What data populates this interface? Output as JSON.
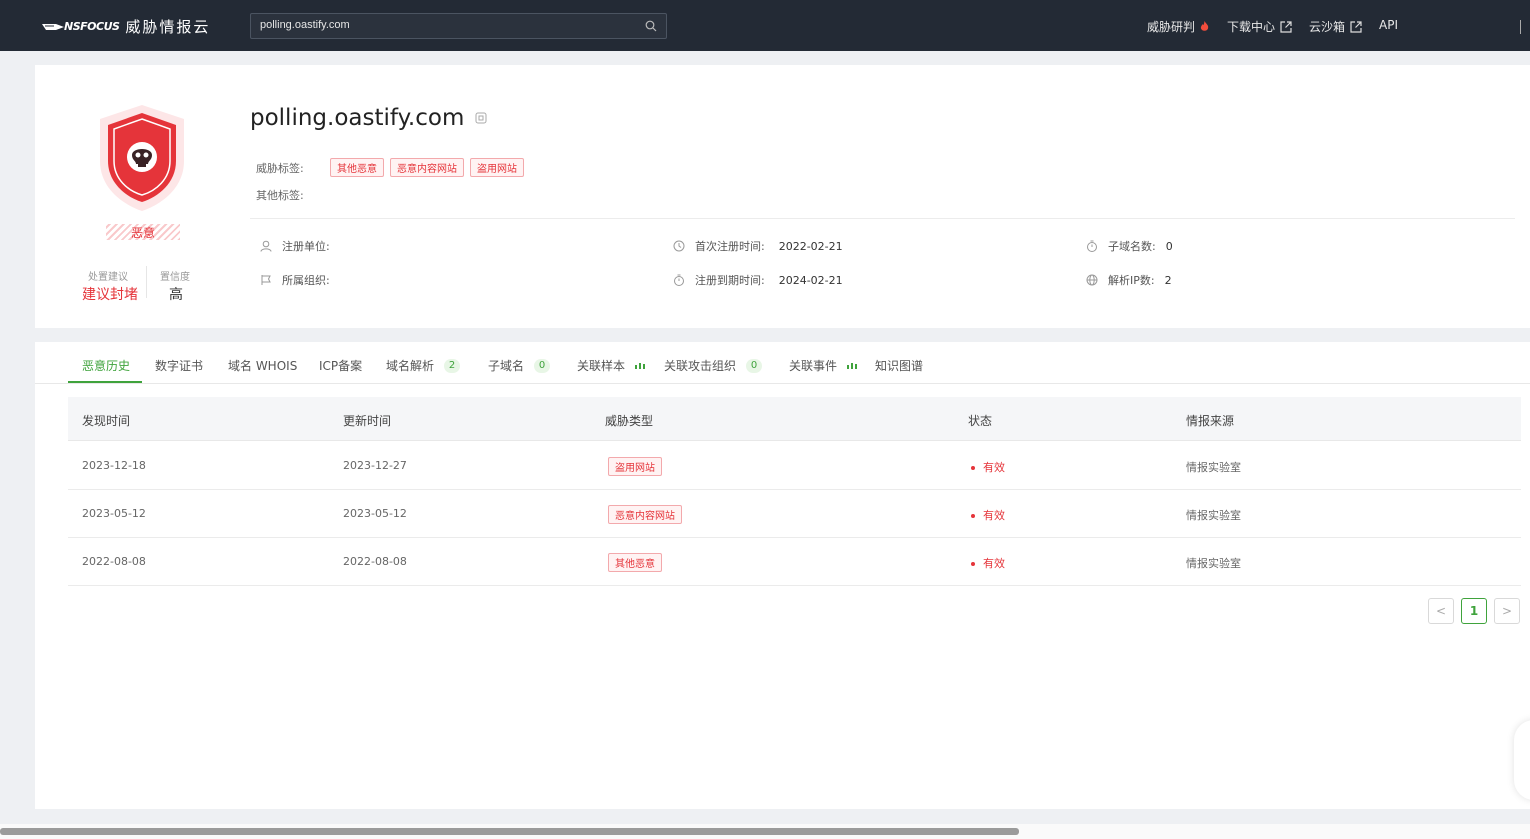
{
  "topbar": {
    "logo_mark": "NSFOCUS",
    "logo_text": "威胁情报云",
    "search_value": "polling.oastify.com",
    "nav": [
      {
        "label": "威胁研判"
      },
      {
        "label": "下载中心"
      },
      {
        "label": "云沙箱"
      },
      {
        "label": "API"
      }
    ]
  },
  "header": {
    "domain": "polling.oastify.com",
    "verdict": "恶意",
    "suggestion_title": "处置建议",
    "suggestion_value": "建议封堵",
    "confidence_title": "置信度",
    "confidence_value": "高",
    "threat_tags_label": "威胁标签:",
    "threat_tags": [
      "其他恶意",
      "恶意内容网站",
      "盗用网站"
    ],
    "other_tags_label": "其他标签:",
    "info": {
      "registrant_label": "注册单位:",
      "registrant_value": "",
      "org_label": "所属组织:",
      "org_value": "",
      "first_reg_label": "首次注册时间:",
      "first_reg_value": "2022-02-21",
      "expire_label": "注册到期时间:",
      "expire_value": "2024-02-21",
      "subdomain_count_label": "子域名数:",
      "subdomain_count_value": "0",
      "ip_count_label": "解析IP数:",
      "ip_count_value": "2"
    },
    "colors": {
      "danger": "#e5343a",
      "accent": "#3fa33c"
    }
  },
  "tabs": [
    {
      "label": "恶意历史"
    },
    {
      "label": "数字证书"
    },
    {
      "label": "域名 WHOIS"
    },
    {
      "label": "ICP备案"
    },
    {
      "label": "域名解析",
      "count": "2"
    },
    {
      "label": "子域名",
      "count": "0"
    },
    {
      "label": "关联样本"
    },
    {
      "label": "关联攻击组织",
      "count": "0"
    },
    {
      "label": "关联事件"
    },
    {
      "label": "知识图谱"
    }
  ],
  "table": {
    "headers": [
      "发现时间",
      "更新时间",
      "威胁类型",
      "状态",
      "情报来源"
    ],
    "rows": [
      {
        "found": "2023-12-18",
        "updated": "2023-12-27",
        "type": "盗用网站",
        "status": "有效",
        "source": "情报实验室"
      },
      {
        "found": "2023-05-12",
        "updated": "2023-05-12",
        "type": "恶意内容网站",
        "status": "有效",
        "source": "情报实验室"
      },
      {
        "found": "2022-08-08",
        "updated": "2022-08-08",
        "type": "其他恶意",
        "status": "有效",
        "source": "情报实验室"
      }
    ]
  },
  "pagination": {
    "prev": "<",
    "current": "1",
    "next": ">"
  }
}
